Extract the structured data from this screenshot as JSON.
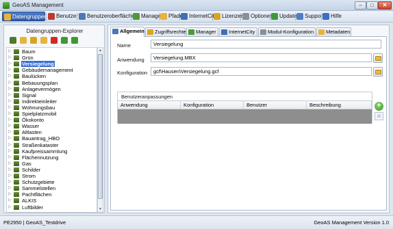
{
  "window": {
    "title": "GeoAS Management",
    "controls": [
      "–",
      "□",
      "✕"
    ]
  },
  "modules": [
    {
      "label": "Datengruppen",
      "icon": "folder-group-icon",
      "color": "#e8b33a",
      "active": true
    },
    {
      "label": "Benutzer",
      "icon": "user-icon",
      "color": "#c0392b"
    },
    {
      "label": "Benutzeroberflächen",
      "icon": "window-icon",
      "color": "#4a78b8"
    },
    {
      "label": "Manager",
      "icon": "manager-icon",
      "color": "#4e9a35"
    },
    {
      "label": "Pfade",
      "icon": "folder-icon",
      "color": "#e8b33a"
    },
    {
      "label": "InternetCity",
      "icon": "city-icon",
      "color": "#3f6fb5"
    },
    {
      "label": "Lizenzen",
      "icon": "key-icon",
      "color": "#d9a520"
    },
    {
      "label": "Optionen",
      "icon": "gear-icon",
      "color": "#8a8f96"
    },
    {
      "label": "Update",
      "icon": "update-icon",
      "color": "#3c9a3a"
    },
    {
      "label": "Support",
      "icon": "support-icon",
      "color": "#4f7ec4"
    },
    {
      "label": "Hilfe",
      "icon": "help-icon",
      "color": "#3a6fc2"
    }
  ],
  "explorer": {
    "title": "Datengruppen-Explorer",
    "toolbar": [
      {
        "icon": "tree-icon",
        "color": "#4e7a2e"
      },
      {
        "icon": "new-folder-icon",
        "color": "#e8b33a"
      },
      {
        "icon": "copy-icon",
        "color": "#d9a520"
      },
      {
        "icon": "add-folder-icon",
        "color": "#e8b33a"
      },
      {
        "icon": "delete-icon",
        "color": "#d22a1e"
      },
      {
        "icon": "arrow-up-icon",
        "color": "#3d9a2f"
      },
      {
        "icon": "arrow-down-icon",
        "color": "#3d9a2f"
      }
    ],
    "items": [
      "Baum",
      "Grün",
      "Versiegelung",
      "Gebäudemanagement",
      "Baulücken",
      "Bebauungsplan",
      "Anlagevermögen",
      "Signal",
      "Indirekteinleiter",
      "Wohnungsbau",
      "Spielplatzmobil",
      "Ökokonto",
      "Wasser",
      "Altlasten",
      "Bauantrag_HBO",
      "Straßenkataster",
      "Kaufpreissammlung",
      "Flächennutzung",
      "Gas",
      "Schilder",
      "Strom",
      "Schutzgebiete",
      "Sammelstellen",
      "Pachtflächen",
      "ALKIS",
      "Luftbilder"
    ],
    "selected_index": 2
  },
  "tabs": [
    {
      "label": "Allgemein",
      "icon": "general-icon",
      "color": "#4a78b8",
      "active": true
    },
    {
      "label": "Zugriffsrechte",
      "icon": "key-icon",
      "color": "#d9a520"
    },
    {
      "label": "Manager",
      "icon": "manager-icon",
      "color": "#4e9a35"
    },
    {
      "label": "InternetCity",
      "icon": "city-icon",
      "color": "#3f6fb5"
    },
    {
      "label": "Modul-Konfiguration",
      "icon": "gear-icon",
      "color": "#8a8f96"
    },
    {
      "label": "Metadaten",
      "icon": "metadata-icon",
      "color": "#e8b33a"
    }
  ],
  "general": {
    "name_label": "Name",
    "name_value": "Versiegelung",
    "application_label": "Anwendung",
    "application_value": "Versiegelung.MBX",
    "config_label": "Konfiguration",
    "config_value": "gcf\\Hausen\\Versiegelung.gcf"
  },
  "user_customizations": {
    "title": "Benutzeranpassungen",
    "columns": [
      "Anwendung",
      "Konfiguration",
      "Benutzer",
      "Beschreibung"
    ],
    "rows": []
  },
  "statusbar": {
    "left": "PE2950 | GeoAS_Testdrive",
    "right": "GeoAS Management Version 1.0"
  },
  "colors": {
    "accent": "#3a6fd0",
    "active_module": "#2e5aa6",
    "empty_grid": "#8e8e8e"
  }
}
